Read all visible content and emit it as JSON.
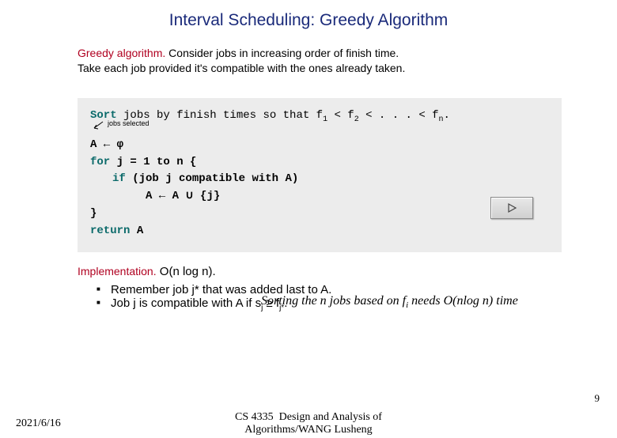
{
  "title": "Interval Scheduling:  Greedy Algorithm",
  "intro": {
    "head": "Greedy algorithm.",
    "line1": "  Consider jobs in increasing order of finish time.",
    "line2": "Take each job provided it's compatible with the ones already taken."
  },
  "code": {
    "sort_kw": "Sort",
    "sort_rest": " jobs by finish times so that f",
    "sort_chain_a": " < f",
    "sort_chain_b": " < . . . < f",
    "sort_tail": ".",
    "note_label": "jobs selected",
    "l_assign_a": "A ← ",
    "phi": "φ",
    "for_kw": "for",
    "for_rest": " j = 1 to n {",
    "if_kw": "if",
    "if_rest": " (job j compatible with A)",
    "union": "A ← A ∪ {j}",
    "rbrace": "}",
    "ret_kw": "return",
    "ret_rest": " A"
  },
  "impl": {
    "head": "Implementation.",
    "bigO": "  O(n log n).",
    "note_a": "Sorting the n jobs based on f",
    "note_sub": "i",
    "note_b": " needs O(nlog n) time",
    "b1": "Remember job j* that was added last to A.",
    "b2_a": "Job j is compatible with A if s",
    "b2_sub1": "j",
    "b2_ge": " ≥ f",
    "b2_sub2": "j*",
    "b2_tail": "."
  },
  "footer": {
    "date": "2021/6/16",
    "center": "CS 4335  Design and Analysis of\nAlgorithms/WANG Lusheng",
    "pagenum": "9"
  }
}
